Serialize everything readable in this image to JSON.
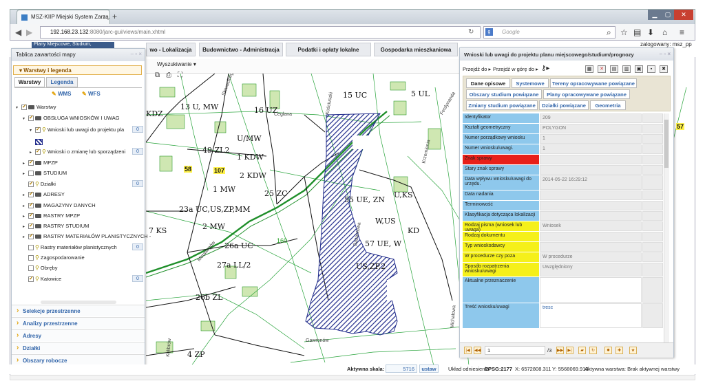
{
  "browser": {
    "tab_title": "MSZ-KIIP Miejski System Zarzą...",
    "url_host": "192.168.23.132",
    "url_path": ":8080/jarc-gui/views/main.xhtml",
    "search_placeholder": "Google",
    "new_tab": "+",
    "close_tab": "×"
  },
  "topmenu": {
    "items": [
      "wo - Lokalizacja",
      "Budownictwo - Administracja",
      "Podatki i opłaty lokalne",
      "Gospodarka mieszkaniowa"
    ],
    "partial_left": "Plany Miejscowe, Studium,",
    "login": "zalogowany: msz_pp"
  },
  "mapbar": {
    "search": "Wyszukiwanie"
  },
  "leftpanel": {
    "title": "Tablica zawartości mapy",
    "section": "Warstwy i legenda",
    "tabs": [
      "Warstwy",
      "Legenda"
    ],
    "buttons": [
      "WMS",
      "WFS"
    ],
    "tree": [
      {
        "label": "Warstwy",
        "level": 0,
        "type": "folder",
        "checked": true
      },
      {
        "label": "OBSŁUGA WNIOSKÓW I UWAG",
        "level": 1,
        "type": "folder",
        "checked": true
      },
      {
        "label": "Wnioski lub uwagi do projektu pla",
        "level": 2,
        "type": "pin",
        "checked": true,
        "count": "0"
      },
      {
        "label": "Wnioski o zmianę lub sporządzeni",
        "level": 2,
        "type": "pin",
        "checked": true,
        "count": "0"
      },
      {
        "label": "MPZP",
        "level": 1,
        "type": "folder",
        "checked": true
      },
      {
        "label": "STUDIUM",
        "level": 1,
        "type": "folder",
        "checked": false
      },
      {
        "label": "Działki",
        "level": 1,
        "type": "pin",
        "checked": true,
        "count": "0"
      },
      {
        "label": "ADRESY",
        "level": 1,
        "type": "folder",
        "checked": true
      },
      {
        "label": "MAGAZYNY DANYCH",
        "level": 1,
        "type": "folder",
        "checked": true
      },
      {
        "label": "RASTRY MPZP",
        "level": 1,
        "type": "folder",
        "checked": true
      },
      {
        "label": "RASTRY STUDIUM",
        "level": 1,
        "type": "folder",
        "checked": true
      },
      {
        "label": "RASTRY MATERIAŁÓW PLANISTYCZNYCH -",
        "level": 1,
        "type": "folder",
        "checked": true
      },
      {
        "label": "Rastry materiałów planistycznych",
        "level": 1,
        "type": "pin",
        "checked": false,
        "count": "0"
      },
      {
        "label": "Zagospodarowanie",
        "level": 1,
        "type": "pin",
        "checked": false
      },
      {
        "label": "Obręby",
        "level": 1,
        "type": "pin",
        "checked": false
      },
      {
        "label": "Katowice",
        "level": 1,
        "type": "pin",
        "checked": true,
        "count": "0"
      }
    ],
    "accordion": [
      "Selekcje przestrzenne",
      "Analizy przestrzenne",
      "Adresy",
      "Działki",
      "Obszary robocze"
    ]
  },
  "rightpanel": {
    "title": "Wnioski lub uwagi do projektu planu miejscowego/studium/prognozy",
    "nav": [
      "Przejdź do",
      "Przejdź w górę do"
    ],
    "tabs_row1": [
      "Dane opisowe",
      "Systemowe",
      "Tereny opracowywane powiązane"
    ],
    "tabs_row2": [
      "Obszary studium powiązane",
      "Plany opracowywane powiązane"
    ],
    "tabs_row3": [
      "Zmiany studium powiązane",
      "Działki powiązane",
      "Geometria"
    ],
    "rows": [
      {
        "label": "Identyfikator",
        "value": "209",
        "color": "#8ec8ec"
      },
      {
        "label": "Kształt geometryczny",
        "value": "POLYGON",
        "color": "#8ec8ec"
      },
      {
        "label": "Numer porządkowy wniosku",
        "value": "1",
        "color": "#8ec8ec"
      },
      {
        "label": "Numer wniosku/uwagi.",
        "value": "1",
        "color": "#8ec8ec"
      },
      {
        "label": "Znak sprawy",
        "value": "",
        "color": "#e8201a"
      },
      {
        "label": "Stary znak sprawy",
        "value": "",
        "color": "#8ec8ec"
      },
      {
        "label": "Data wpływu wniosku/uwagi do urzędu.",
        "value": "2014-05-22 16:29:12",
        "color": "#8ec8ec"
      },
      {
        "label": "Data nadania",
        "value": "",
        "color": "#8ec8ec"
      },
      {
        "label": "Terminowość",
        "value": "",
        "color": "#8ec8ec"
      },
      {
        "label": "Klasyfikacja dotycząca lokalizacji",
        "value": "",
        "color": "#8ec8ec"
      },
      {
        "label": "Rodzaj pisma (wniosek lub uwaga)",
        "value": "Wniosek",
        "color": "#f5f01a"
      },
      {
        "label": "Rodzaj dokumentu",
        "value": "",
        "color": "#f5f01a"
      },
      {
        "label": "Typ wnioskodawcy",
        "value": "",
        "color": "#f5f01a"
      },
      {
        "label": "W procedurze czy poza",
        "value": "W procedurze",
        "color": "#f5f01a"
      },
      {
        "label": "Sposób rozpatrzenia wniosku/uwagi",
        "value": "Uwzględniony",
        "color": "#f5f01a"
      },
      {
        "label": "Aktualne przeznaczenie",
        "value": "",
        "color": "#8ec8ec"
      },
      {
        "label": "Treść wniosku/uwagi",
        "value": "tresc",
        "color": "#8ec8ec"
      }
    ],
    "pager": {
      "page": "1",
      "total": "/3"
    }
  },
  "statusbar": {
    "scale_label": "Aktywna skala:",
    "scale_value": "5716",
    "set_button": "ustaw",
    "crs_label": "Układ odniesienia",
    "crs_value": "EPSG:2177",
    "x": "X: 6572808.311",
    "y": "Y: 5568069.913",
    "active_layer": "Aktywna warstwa:  Brak aktywnej warstwy"
  },
  "map": {
    "labels": [
      "13 U, MW",
      "16 UZ",
      "15 UC",
      "5 UL",
      "KDZ",
      "U/MW",
      "49 ZL2",
      "1 KDW",
      "58",
      "107",
      "2 KDW",
      "1 MW",
      "25 ZC",
      "23a UC,US,ZP,MM",
      "2 MW",
      "55 UE, ZN",
      "U,KS",
      "W,US",
      "KD",
      "57 UE, W",
      "7 KS",
      "26a UC",
      "160",
      "27a LL/2",
      "US,ZP,2",
      "26b ZL",
      "4 ZP",
      "57"
    ],
    "streets": [
      "Ceglana",
      "Gawronów",
      "Kościuszki",
      "Krzemienia",
      "Michałowa",
      "Kolibrów",
      "Słowackiego",
      "Bażantowa",
      "Metalurgów",
      "Ferdynanda"
    ]
  }
}
